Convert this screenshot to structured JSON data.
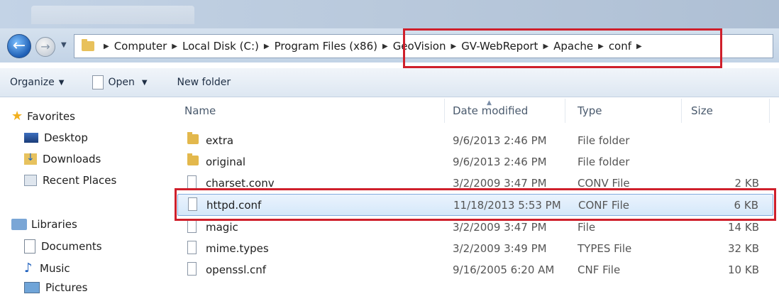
{
  "address": {
    "crumbs": [
      "Computer",
      "Local Disk (C:)",
      "Program Files (x86)",
      "GeoVision",
      "GV-WebReport",
      "Apache",
      "conf"
    ]
  },
  "toolbar": {
    "organize": "Organize",
    "open": "Open",
    "new_folder": "New folder"
  },
  "nav": {
    "favorites": "Favorites",
    "desktop": "Desktop",
    "downloads": "Downloads",
    "recent": "Recent Places",
    "libraries": "Libraries",
    "documents": "Documents",
    "music": "Music",
    "pictures": "Pictures"
  },
  "columns": {
    "name": "Name",
    "date": "Date modified",
    "type": "Type",
    "size": "Size"
  },
  "files": [
    {
      "name": "extra",
      "date": "9/6/2013 2:46 PM",
      "type": "File folder",
      "size": "",
      "icon": "folder-icon"
    },
    {
      "name": "original",
      "date": "9/6/2013 2:46 PM",
      "type": "File folder",
      "size": "",
      "icon": "folder-icon"
    },
    {
      "name": "charset.conv",
      "date": "3/2/2009 3:47 PM",
      "type": "CONV File",
      "size": "2 KB",
      "icon": "file-icon"
    },
    {
      "name": "httpd.conf",
      "date": "11/18/2013 5:53 PM",
      "type": "CONF File",
      "size": "6 KB",
      "icon": "file-icon"
    },
    {
      "name": "magic",
      "date": "3/2/2009 3:47 PM",
      "type": "File",
      "size": "14 KB",
      "icon": "file-icon"
    },
    {
      "name": "mime.types",
      "date": "3/2/2009 3:49 PM",
      "type": "TYPES File",
      "size": "32 KB",
      "icon": "file-icon"
    },
    {
      "name": "openssl.cnf",
      "date": "9/16/2005 6:20 AM",
      "type": "CNF File",
      "size": "10 KB",
      "icon": "file-icon"
    }
  ],
  "colors": {
    "highlight": "#cf1f2b",
    "selection": "#d5e8fa",
    "folder": "#e3b84c"
  }
}
